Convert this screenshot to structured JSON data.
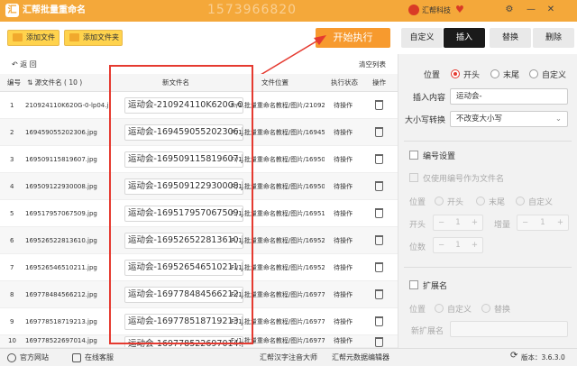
{
  "app": {
    "title": "汇帮批量重命名",
    "watermark": "1573966820",
    "brand": "汇帮科技",
    "logo_text": "汇"
  },
  "toolbar": {
    "add_file": "添加文件",
    "add_folder": "添加文件夹",
    "start": "开始执行"
  },
  "tabs": [
    "自定义",
    "插入",
    "替换",
    "删除"
  ],
  "subbar": {
    "back": "返 回",
    "clear": "清空列表"
  },
  "table": {
    "headers": [
      "编号",
      "源文件名 ( 10 )",
      "新文件名",
      "文件位置",
      "执行状态",
      "操作"
    ],
    "rows": [
      {
        "no": "1",
        "src": "210924110K620G-0-lp04.jpg",
        "new": "运动会-210924110K620G-0-lp04.jpg",
        "loc": "F:/1.批量重命名教程/图片/210924110K620G-0-lp04.jpg",
        "status": "待操作"
      },
      {
        "no": "2",
        "src": "169459055202306.jpg",
        "new": "运动会-169459055202306.jpg",
        "loc": "F:/1.批量重命名教程/图片/169459055202306.jpg",
        "status": "待操作"
      },
      {
        "no": "3",
        "src": "169509115819607.jpg",
        "new": "运动会-169509115819607.jpg",
        "loc": "F:/1.批量重命名教程/图片/169509115819607.jpg",
        "status": "待操作"
      },
      {
        "no": "4",
        "src": "169509122930008.jpg",
        "new": "运动会-169509122930008.jpg",
        "loc": "F:/1.批量重命名教程/图片/169509122930008.jpg",
        "status": "待操作"
      },
      {
        "no": "5",
        "src": "169517957067509.jpg",
        "new": "运动会-169517957067509.jpg",
        "loc": "F:/1.批量重命名教程/图片/169517957067509.jpg",
        "status": "待操作"
      },
      {
        "no": "6",
        "src": "169526522813610.jpg",
        "new": "运动会-169526522813610.jpg",
        "loc": "F:/1.批量重命名教程/图片/169526522813610.jpg",
        "status": "待操作"
      },
      {
        "no": "7",
        "src": "169526546510211.jpg",
        "new": "运动会-169526546510211.jpg",
        "loc": "F:/1.批量重命名教程/图片/169526546510211.jpg",
        "status": "待操作"
      },
      {
        "no": "8",
        "src": "169778484566212.jpg",
        "new": "运动会-169778484566212.jpg",
        "loc": "F:/1.批量重命名教程/图片/169778484566212.jpg",
        "status": "待操作"
      },
      {
        "no": "9",
        "src": "169778518719213.jpg",
        "new": "运动会-169778518719213.jpg",
        "loc": "F:/1.批量重命名教程/图片/169778518719213.jpg",
        "status": "待操作"
      },
      {
        "no": "10",
        "src": "169778522697014.jpg",
        "new": "运动会-169778522697014.jpg",
        "loc": "F:/1.批量重命名教程/图片/169778522697014.jpg",
        "status": "待操作"
      }
    ]
  },
  "sidebar": {
    "position_label": "位置",
    "position_options": [
      "开头",
      "末尾",
      "自定义"
    ],
    "insert_label": "插入内容",
    "insert_value": "运动会-",
    "case_label": "大小写转换",
    "case_value": "不改变大小写",
    "numbering_label": "编号设置",
    "only_numbering_label": "仅使用编号作为文件名",
    "num_position_label": "位置",
    "num_position_options": [
      "开头",
      "末尾",
      "自定义"
    ],
    "start_label": "开头",
    "start_value": "1",
    "increment_label": "增量",
    "increment_value": "1",
    "digits_label": "位数",
    "digits_value": "1",
    "ext_label": "扩展名",
    "ext_position_label": "位置",
    "ext_options": [
      "自定义",
      "替换"
    ],
    "new_ext_label": "新扩展名"
  },
  "footer": {
    "website": "官方网站",
    "support": "在线客服",
    "app1": "汇帮汉字注音大师",
    "app2": "汇帮元数据编辑器",
    "version": "版本：3.6.3.0"
  },
  "colors": {
    "titlebar": "#f4a83a",
    "start_button": "#f79a2e",
    "highlight_box": "#e53a30",
    "active_tab": "#1a1a1a"
  }
}
